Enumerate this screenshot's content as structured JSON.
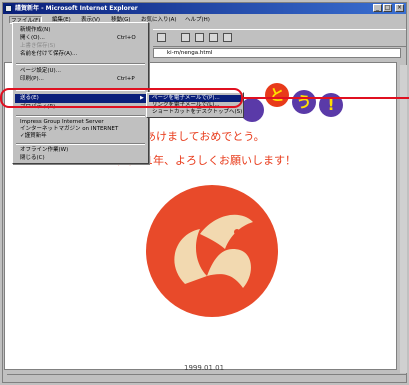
{
  "window": {
    "title": "謹賀新年 - Microsoft Internet Explorer",
    "controls": {
      "minimize": "_",
      "maximize": "□",
      "close": "×"
    }
  },
  "menubar": {
    "items": [
      "ファイル(F)",
      "編集(E)",
      "表示(V)",
      "移動(G)",
      "お気に入り(A)",
      "ヘルプ(H)"
    ]
  },
  "addressbar": {
    "value": "ki-m/nenga.html"
  },
  "file_menu": {
    "items": [
      {
        "label": "新規作成(N)",
        "shortcut": ""
      },
      {
        "label": "開く(O)...",
        "shortcut": "Ctrl+O"
      },
      {
        "label": "上書き保存(S)",
        "shortcut": "",
        "disabled": true
      },
      {
        "label": "名前を付けて保存(A)...",
        "shortcut": ""
      },
      {
        "label": "ページ設定(U)...",
        "shortcut": ""
      },
      {
        "label": "印刷(P)...",
        "shortcut": "Ctrl+P"
      },
      {
        "label": "送る(E)",
        "shortcut": ""
      },
      {
        "label": "プロパティ(R)",
        "shortcut": ""
      },
      {
        "label": "Impress Group Internet Server",
        "shortcut": ""
      },
      {
        "label": "インターネットマガジン on INTERNET",
        "shortcut": ""
      },
      {
        "label": "✓謹賀新年",
        "shortcut": ""
      },
      {
        "label": "オフライン作業(W)",
        "shortcut": ""
      },
      {
        "label": "閉じる(C)",
        "shortcut": ""
      }
    ]
  },
  "submenu": {
    "items": [
      "ページを電子メールで(P)...",
      "リンクを電子メールで(L)...",
      "ショートカットをデスクトップへ(S)"
    ]
  },
  "content": {
    "banner_letters": [
      "と",
      "う",
      "!"
    ],
    "greeting_line1": "あけましておめでとう。",
    "greeting_line2": "今年も1年、よろしくお願いします！",
    "footer_date": "1999.01.01"
  },
  "colors": {
    "title_bar": "#0a1f7a",
    "greeting_text": "#e83a1a",
    "emblem_red": "#e84a2a",
    "emblem_cream": "#f2d9b0",
    "annotation": "#e01020"
  }
}
